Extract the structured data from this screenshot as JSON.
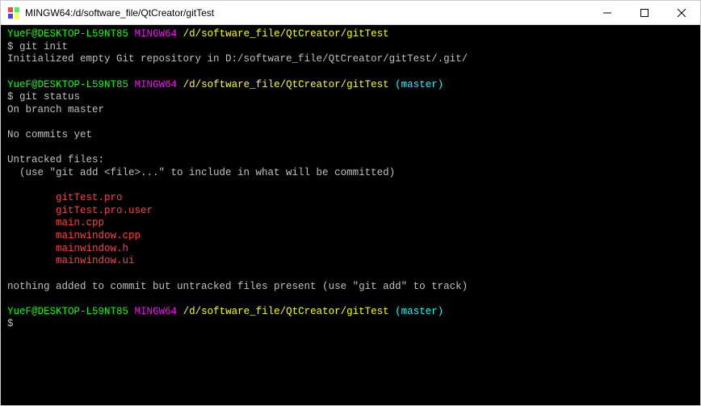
{
  "window": {
    "title": "MINGW64:/d/software_file/QtCreator/gitTest"
  },
  "prompt1": {
    "user_host": "YueF@DESKTOP-L59NT85",
    "env": "MINGW64",
    "path": "/d/software_file/QtCreator/gitTest",
    "cmd_prefix": "$ ",
    "cmd": "git init"
  },
  "init_output": "Initialized empty Git repository in D:/software_file/QtCreator/gitTest/.git/",
  "prompt2": {
    "user_host": "YueF@DESKTOP-L59NT85",
    "env": "MINGW64",
    "path": "/d/software_file/QtCreator/gitTest",
    "branch": "(master)",
    "cmd_prefix": "$ ",
    "cmd": "git status"
  },
  "status": {
    "on_branch": "On branch master",
    "no_commits": "No commits yet",
    "untracked_header": "Untracked files:",
    "untracked_hint": "(use \"git add <file>...\" to include in what will be committed)",
    "files": [
      "gitTest.pro",
      "gitTest.pro.user",
      "main.cpp",
      "mainwindow.cpp",
      "mainwindow.h",
      "mainwindow.ui"
    ],
    "nothing_added": "nothing added to commit but untracked files present (use \"git add\" to track)"
  },
  "prompt3": {
    "user_host": "YueF@DESKTOP-L59NT85",
    "env": "MINGW64",
    "path": "/d/software_file/QtCreator/gitTest",
    "branch": "(master)",
    "cmd_prefix": "$"
  }
}
